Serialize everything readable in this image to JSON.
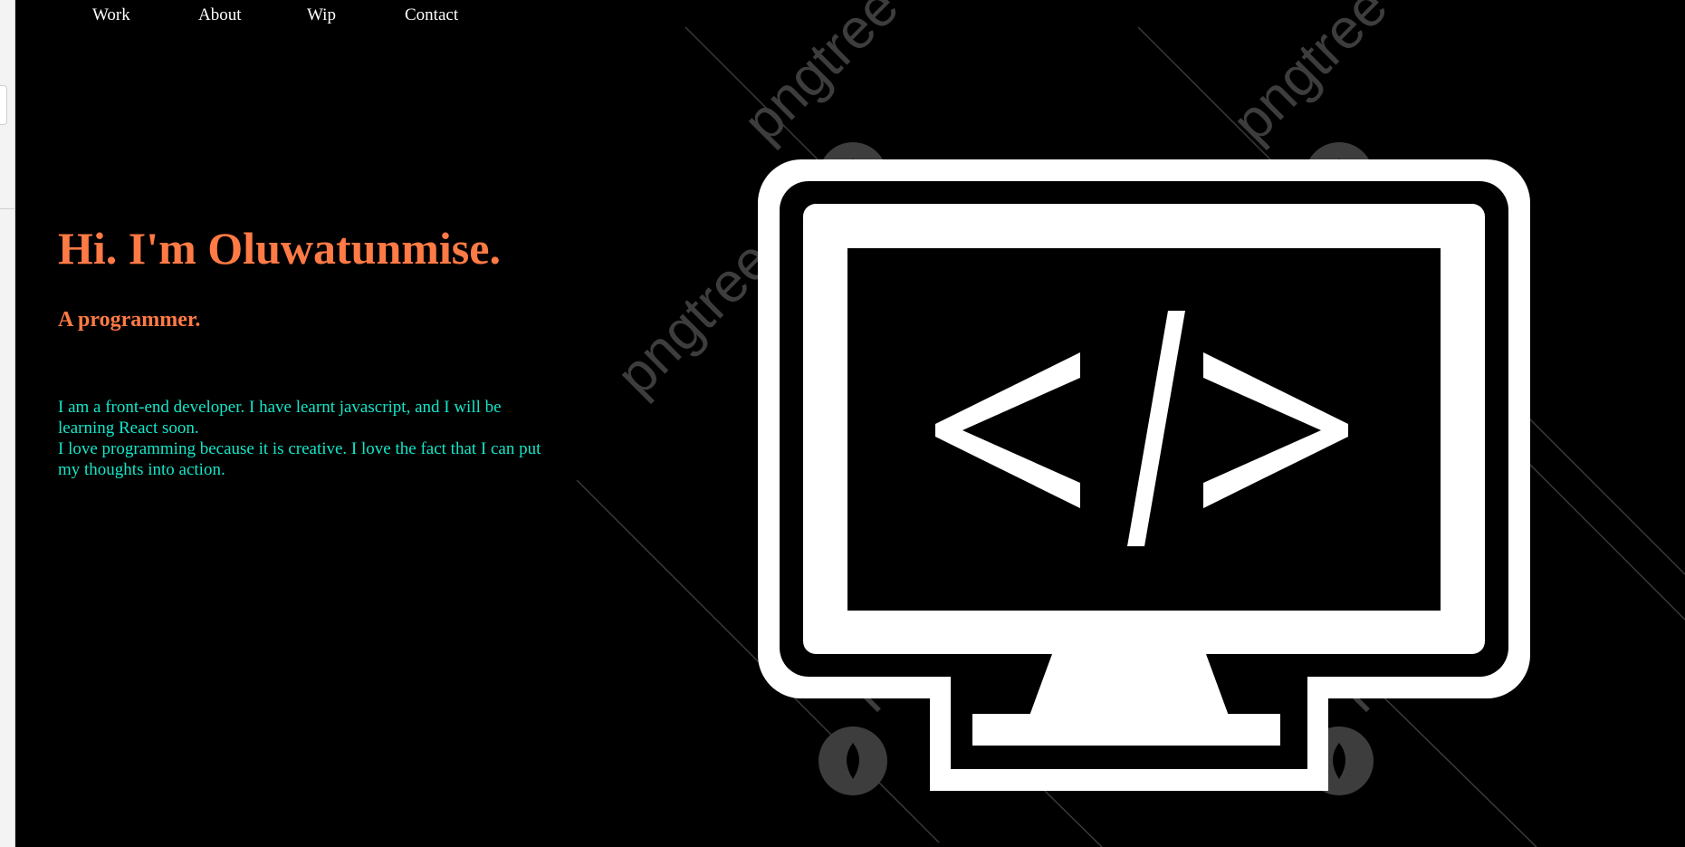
{
  "nav": {
    "items": [
      {
        "label": "Work"
      },
      {
        "label": "About"
      },
      {
        "label": "Wip"
      },
      {
        "label": "Contact"
      }
    ]
  },
  "hero": {
    "title": "Hi. I'm Oluwatunmise.",
    "subtitle": "A programmer.",
    "bio_lines": [
      "I am a front-end developer. I have learnt javascript, and I will be learning React soon.",
      "I love programming because it is creative. I love the fact that I can put my thoughts into action."
    ]
  },
  "illustration": {
    "code_symbol": "</>",
    "watermark_text": "pngtree"
  },
  "colors": {
    "background": "#000000",
    "heading": "#ff7a45",
    "bio_text": "#14e6c8",
    "nav_text": "#ffffff",
    "illustration": "#ffffff"
  }
}
